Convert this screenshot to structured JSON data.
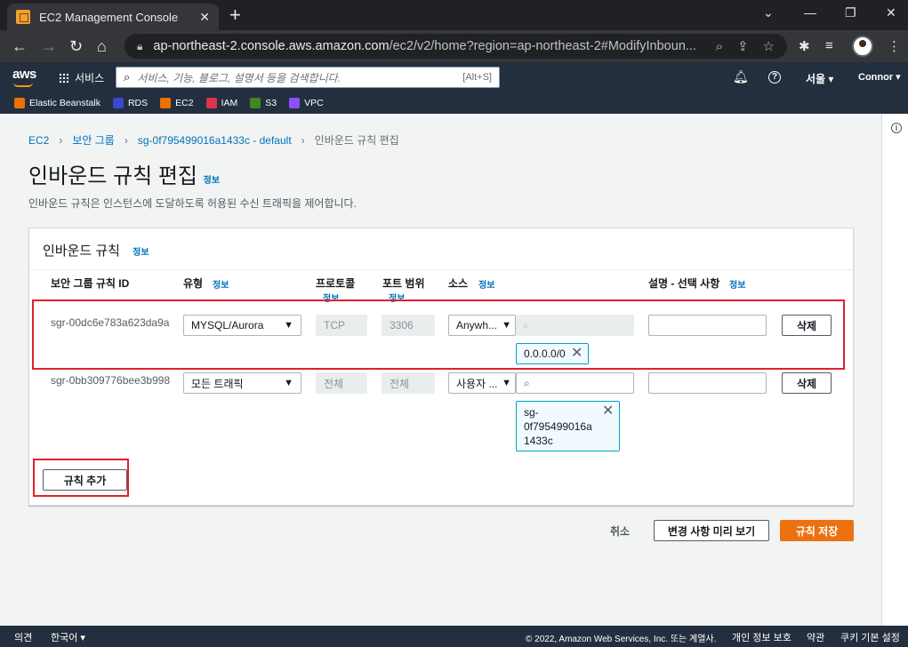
{
  "browser": {
    "tab_title": "EC2 Management Console",
    "url_host": "ap-northeast-2.console.aws.amazon.com",
    "url_path": "/ec2/v2/home?region=ap-northeast-2#ModifyInboun..."
  },
  "aws_nav": {
    "logo": "aws",
    "services": "서비스",
    "search_placeholder": "서비스, 기능, 블로그, 설명서 등을 검색합니다.",
    "search_shortcut": "[Alt+S]",
    "region": "서울 ▾",
    "user": "Connor ▾"
  },
  "bookmarks": [
    {
      "label": "Elastic Beanstalk",
      "color": "#ed7100"
    },
    {
      "label": "RDS",
      "color": "#3b48cc"
    },
    {
      "label": "EC2",
      "color": "#ed7100"
    },
    {
      "label": "IAM",
      "color": "#dd344c"
    },
    {
      "label": "S3",
      "color": "#3f8624"
    },
    {
      "label": "VPC",
      "color": "#8c4fff"
    }
  ],
  "breadcrumb": {
    "ec2": "EC2",
    "security_groups": "보안 그룹",
    "sg": "sg-0f795499016a1433c - default",
    "current": "인바운드 규칙 편집"
  },
  "page": {
    "title": "인바운드 규칙 편집",
    "info": "정보",
    "description": "인바운드 규칙은 인스턴스에 도달하도록 허용된 수신 트래픽을 제어합니다."
  },
  "panel": {
    "title": "인바운드 규칙",
    "info": "정보",
    "headers": {
      "rule_id": "보안 그룹 규칙 ID",
      "type": "유형",
      "protocol": "프로토콜",
      "port_range": "포트 범위",
      "source": "소스",
      "description": "설명 - 선택 사항",
      "info": "정보"
    },
    "rules": [
      {
        "id": "sgr-00dc6e783a623da9a",
        "type": "MYSQL/Aurora",
        "protocol": "TCP",
        "port": "3306",
        "source_type": "Anywh...",
        "source_search": "",
        "token": "0.0.0.0/0",
        "description": "",
        "delete": "삭제"
      },
      {
        "id": "sgr-0bb309776bee3b998",
        "type": "모든 트래픽",
        "protocol": "전체",
        "port": "전체",
        "source_type": "사용자 ...",
        "source_search": "",
        "token_lines": [
          "sg-",
          "0f795499016a",
          "1433c"
        ],
        "description": "",
        "delete": "삭제"
      }
    ],
    "add_rule": "규칙 추가"
  },
  "actions": {
    "cancel": "취소",
    "preview": "변경 사항 미리 보기",
    "save": "규칙 저장"
  },
  "footer": {
    "feedback": "의견",
    "language": "한국어 ▾",
    "copyright": "© 2022, Amazon Web Services, Inc. 또는 계열사.",
    "privacy": "개인 정보 보호",
    "terms": "약관",
    "cookies": "쿠키 기본 설정"
  },
  "colors": {
    "aws_nav": "#232f3e",
    "link": "#0073bb",
    "primary": "#ec7211",
    "highlight": "#e0202e"
  }
}
